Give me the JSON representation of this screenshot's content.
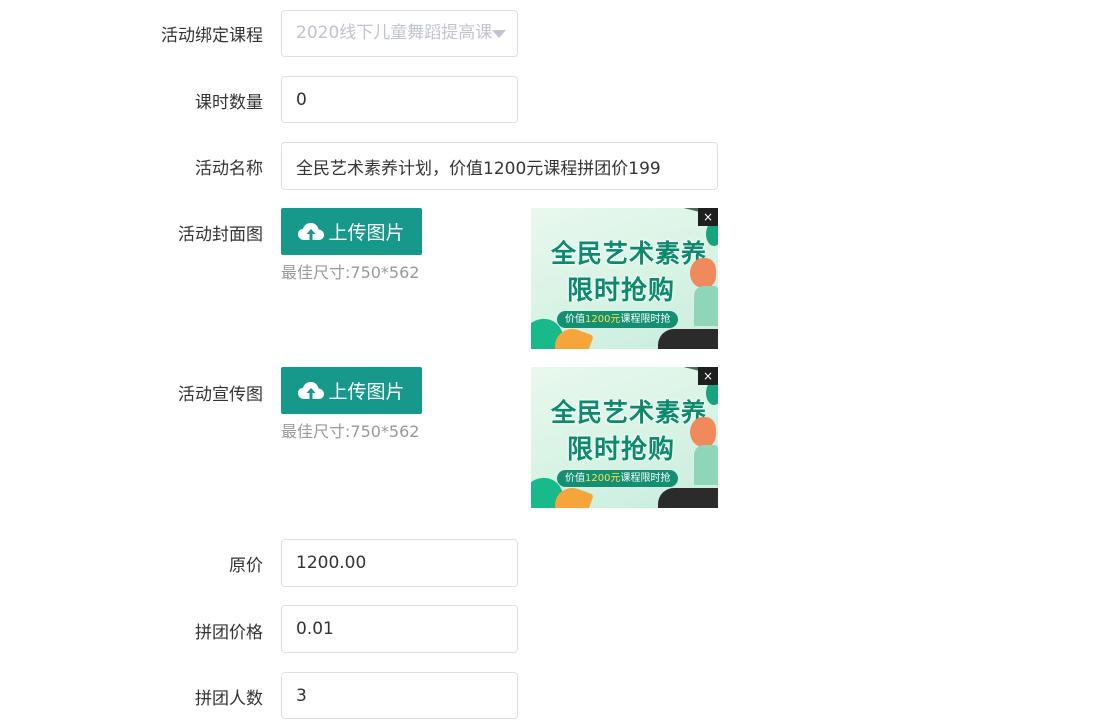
{
  "form": {
    "course": {
      "label": "活动绑定课程",
      "value": "2020线下儿童舞蹈提高课"
    },
    "lessons": {
      "label": "课时数量",
      "value": "0"
    },
    "name": {
      "label": "活动名称",
      "value": "全民艺术素养计划，价值1200元课程拼团价199"
    },
    "cover": {
      "label": "活动封面图",
      "upload_label": "上传图片",
      "hint": "最佳尺寸:750*562",
      "image": {
        "line1": "全民艺术素养",
        "line2": "限时抢购",
        "pill_pre": "价值",
        "pill_highlight": "1200元",
        "pill_post": "课程限时抢",
        "close": "×"
      }
    },
    "promo": {
      "label": "活动宣传图",
      "upload_label": "上传图片",
      "hint": "最佳尺寸:750*562",
      "image": {
        "line1": "全民艺术素养",
        "line2": "限时抢购",
        "pill_pre": "价值",
        "pill_highlight": "1200元",
        "pill_post": "课程限时抢",
        "close": "×"
      }
    },
    "original_price": {
      "label": "原价",
      "value": "1200.00"
    },
    "group_price": {
      "label": "拼团价格",
      "value": "0.01"
    },
    "group_size": {
      "label": "拼团人数",
      "value": "3"
    }
  },
  "colors": {
    "primary": "#16998a",
    "border": "#dcdfe6",
    "hint": "#999999",
    "disabled_text": "#c0c4cc"
  },
  "icons": {
    "upload": "cloud-upload-icon",
    "select_caret": "caret-down-icon",
    "remove": "close-icon"
  }
}
